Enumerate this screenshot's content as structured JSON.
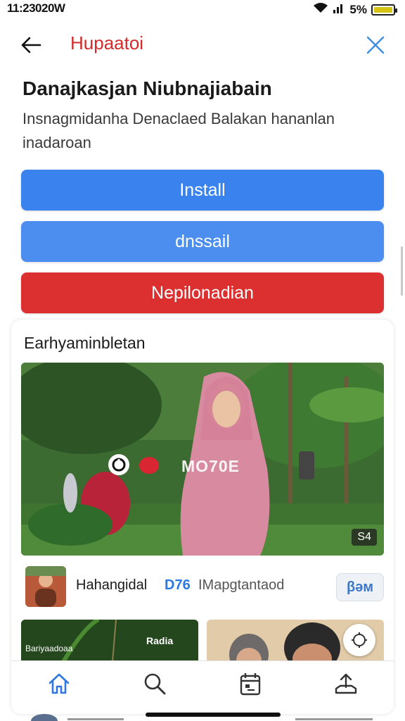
{
  "status_bar": {
    "time": "11:23020W",
    "signal_text": "5%",
    "battery_color": "#d6c414"
  },
  "header": {
    "title": "Hupaatoi",
    "back_icon": "arrow-left-icon",
    "close_icon": "close-icon",
    "title_color": "#d32b2b",
    "close_color": "#3d8de0"
  },
  "intro": {
    "title": "Danajkasjan Niubnajiabain",
    "subtitle": "Insnagmidanha Denaclaed Balakan hananlan inadaroan"
  },
  "actions": {
    "install_label": "Install",
    "install2_label": "dnssail",
    "red_label": "Nepilonadian",
    "install_color": "#3a82ee",
    "red_color": "#dc3030"
  },
  "feed": {
    "title": "Earhyaminbletan",
    "video": {
      "overlay_label": "MO70E",
      "duration": "S4"
    },
    "channel": {
      "name": "Hahangidal",
      "count": "D76",
      "meta": "IMapgtantaod",
      "follow_label": "βəм"
    },
    "thumbs": [
      {
        "caption_left": "Bariyaadoaa",
        "caption_right": "Radia"
      }
    ]
  },
  "bottom_nav": {
    "items": [
      {
        "icon": "home-icon",
        "active": true
      },
      {
        "icon": "search-icon",
        "active": false
      },
      {
        "icon": "calendar-icon",
        "active": false
      },
      {
        "icon": "upload-icon",
        "active": false
      }
    ],
    "active_color": "#2f78e0"
  }
}
